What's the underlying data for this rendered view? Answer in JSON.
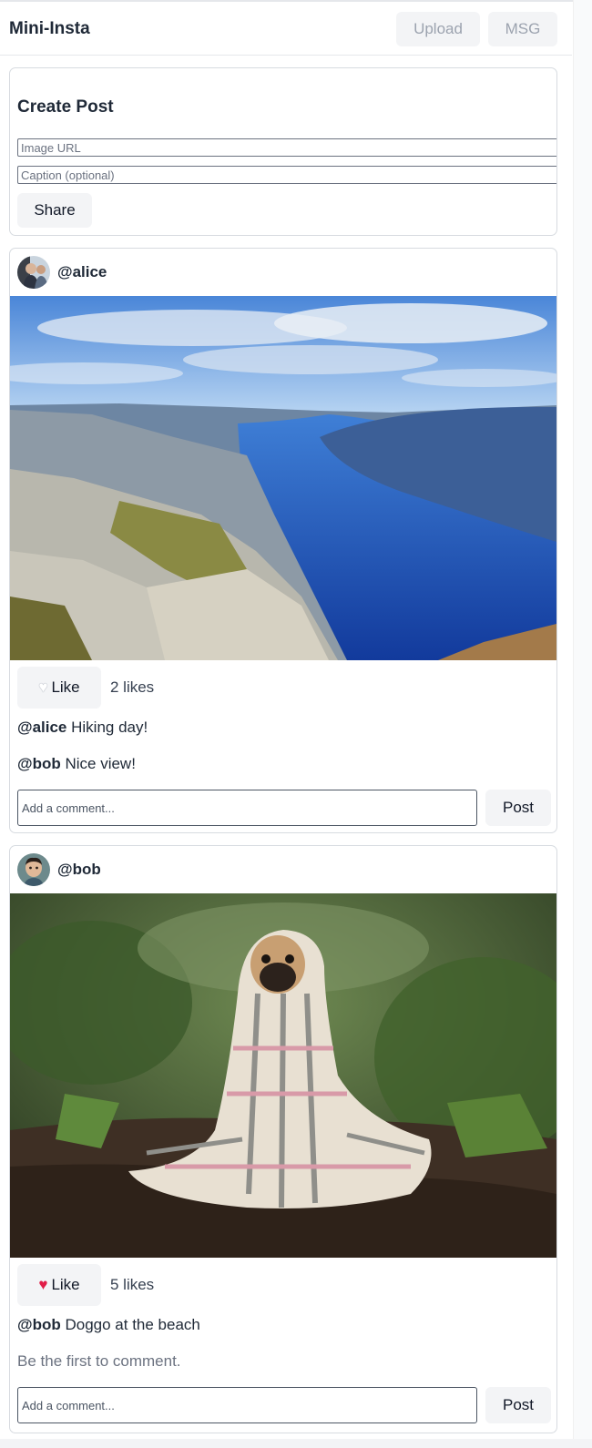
{
  "header": {
    "title": "Mini-Insta",
    "upload_label": "Upload",
    "msg_label": "MSG"
  },
  "create_post": {
    "title": "Create Post",
    "image_url_placeholder": "Image URL",
    "caption_placeholder": "Caption (optional)",
    "share_label": "Share"
  },
  "posts": [
    {
      "author": "@alice",
      "like_icon": "white-heart-icon",
      "like_label": "Like",
      "likes_text": "2 likes",
      "caption_author": "@alice",
      "caption_text": "Hiking day!",
      "comment_author": "@bob",
      "comment_text": "Nice view!",
      "comment_placeholder": "Add a comment...",
      "post_label": "Post"
    },
    {
      "author": "@bob",
      "like_icon": "red-heart-icon",
      "like_label": "Like",
      "likes_text": "5 likes",
      "caption_author": "@bob",
      "caption_text": "Doggo at the beach",
      "empty_comments_text": "Be the first to comment.",
      "comment_placeholder": "Add a comment...",
      "post_label": "Post"
    }
  ],
  "colors": {
    "accent_red": "#e11d48",
    "button_bg": "#f3f4f6",
    "border": "#d7dbe0"
  }
}
